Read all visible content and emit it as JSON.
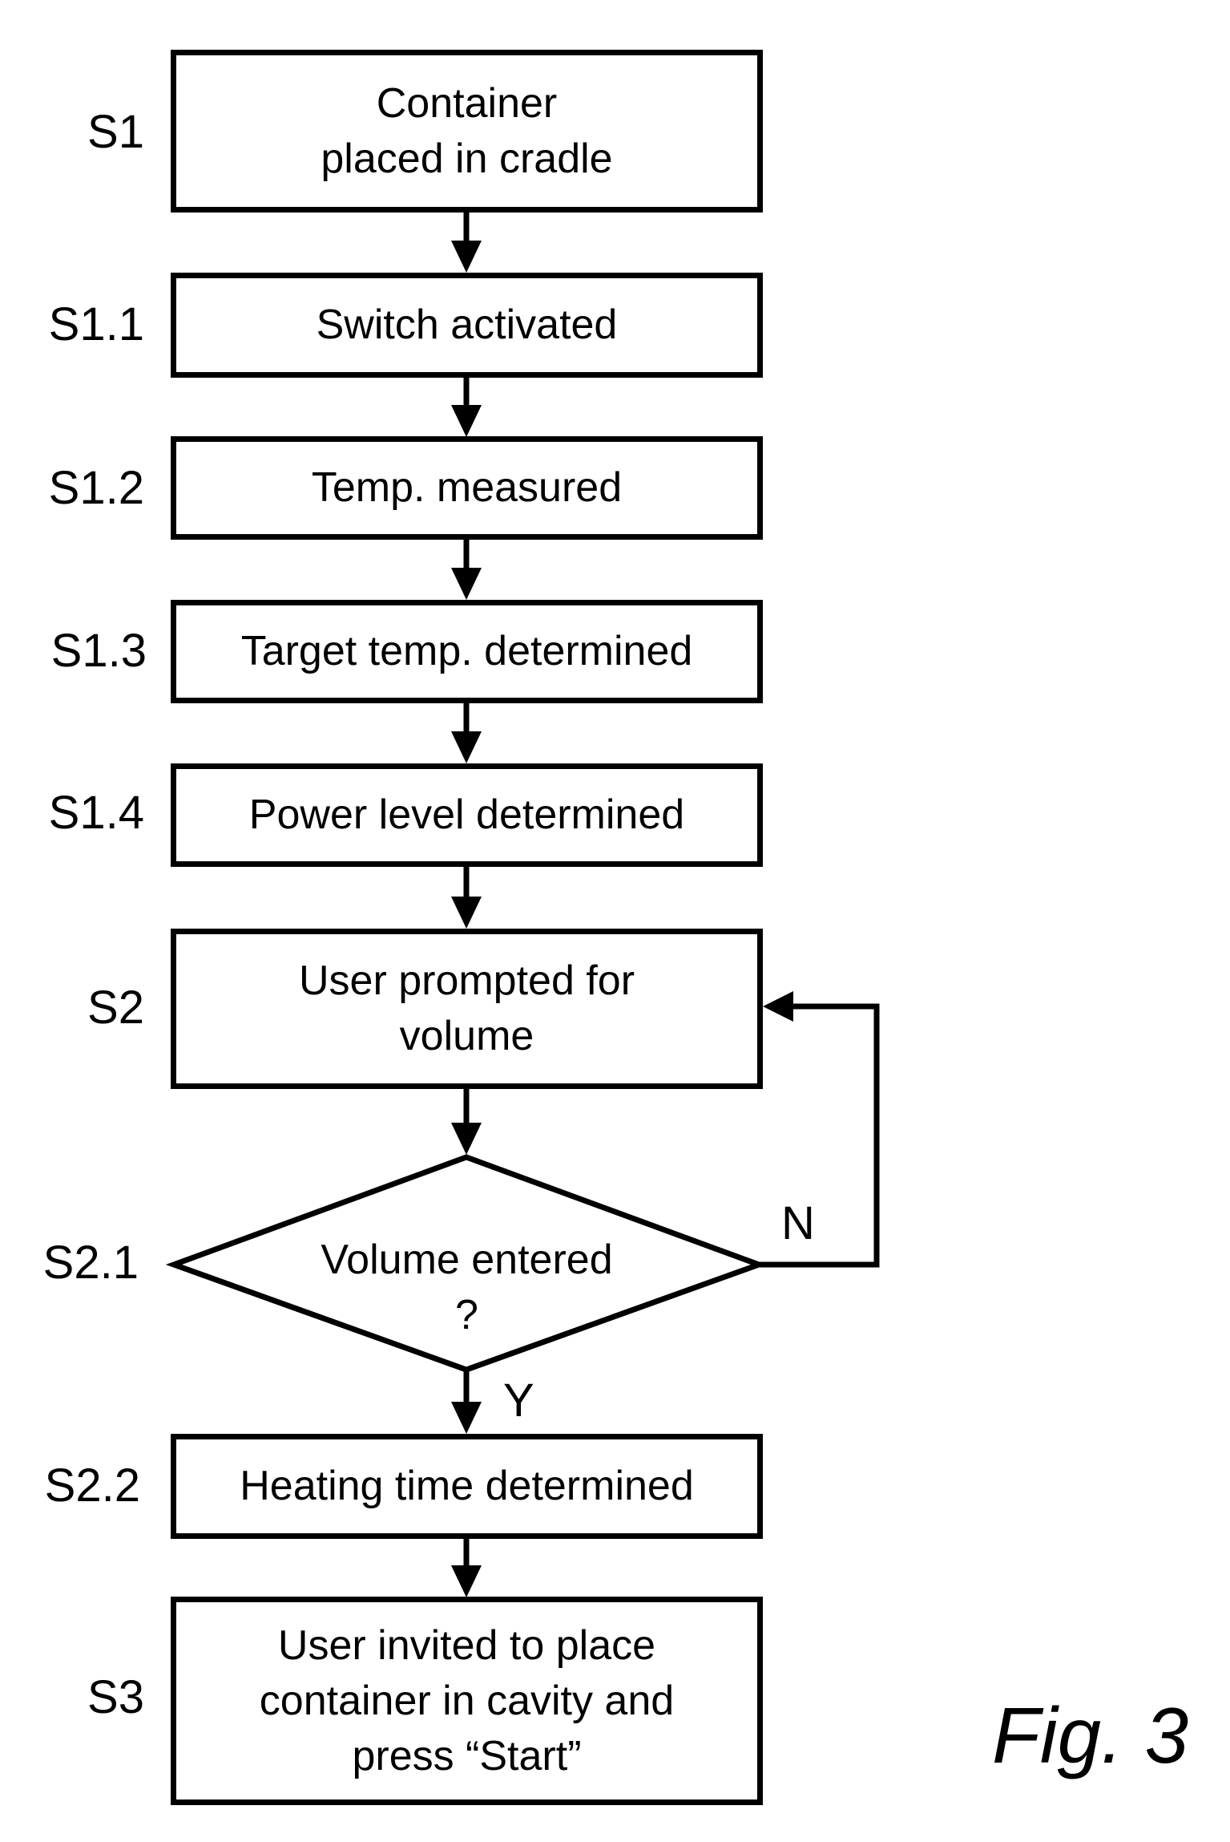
{
  "figure": {
    "caption": "Fig. 3",
    "steps": [
      {
        "id": "S1",
        "label": "Container\nplaced in cradle"
      },
      {
        "id": "S1.1",
        "label": "Switch activated"
      },
      {
        "id": "S1.2",
        "label": "Temp. measured"
      },
      {
        "id": "S1.3",
        "label": "Target temp. determined"
      },
      {
        "id": "S1.4",
        "label": "Power level determined"
      },
      {
        "id": "S2",
        "label": "User prompted for\nvolume"
      },
      {
        "id": "S2.1",
        "label": "Volume entered\n?"
      },
      {
        "id": "S2.2",
        "label": "Heating time determined"
      },
      {
        "id": "S3",
        "label": "User invited to place\ncontainer in cavity and\npress “Start”"
      }
    ],
    "decision": {
      "yes_label": "Y",
      "no_label": "N"
    },
    "colors": {
      "stroke": "#000000",
      "background": "#ffffff"
    }
  }
}
